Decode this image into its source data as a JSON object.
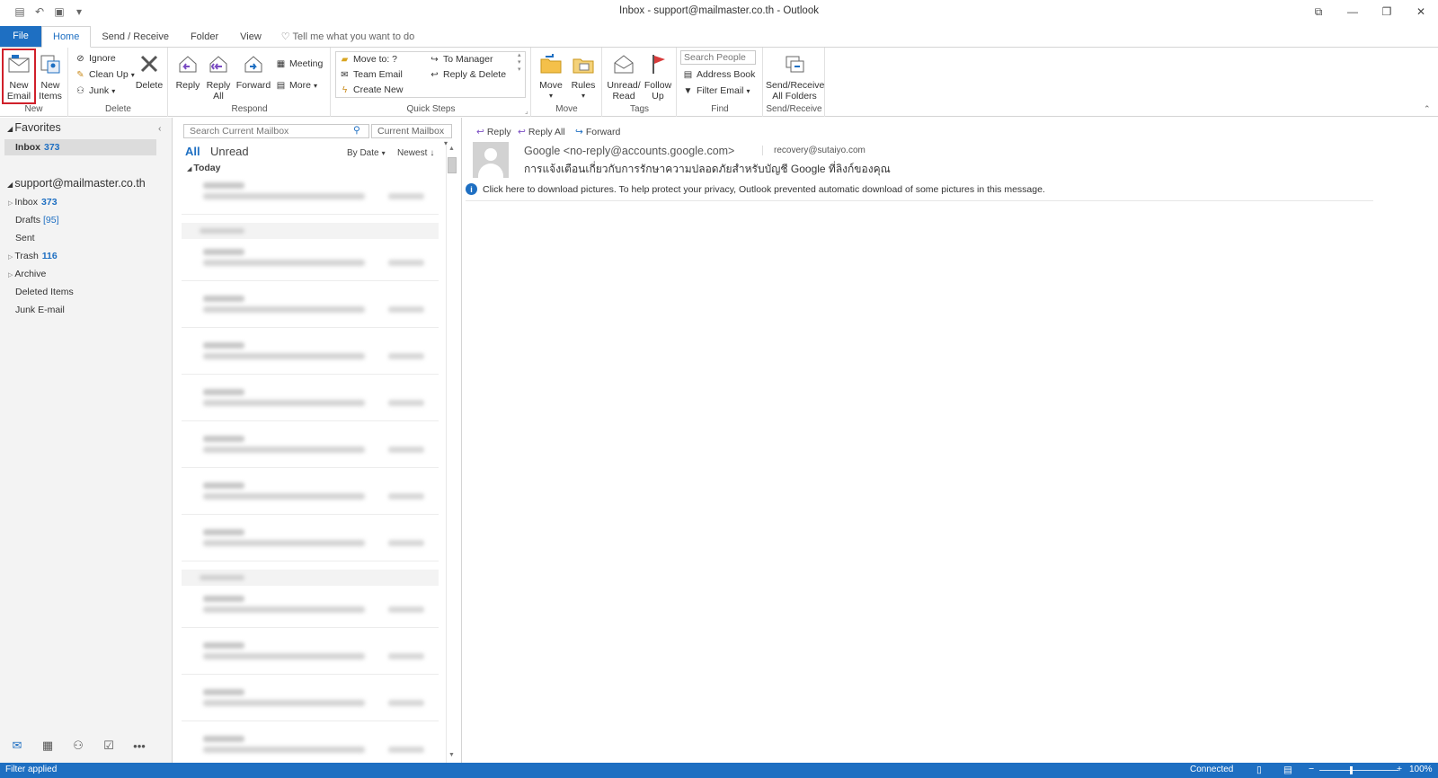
{
  "window": {
    "title": "Inbox - support@mailmaster.co.th  -  Outlook"
  },
  "tabs": [
    "File",
    "Home",
    "Send / Receive",
    "Folder",
    "View"
  ],
  "tell_me": "Tell me what you want to do",
  "ribbon": {
    "new": {
      "label": "New",
      "new_email": "New Email",
      "new_items": "New Items"
    },
    "delete": {
      "label": "Delete",
      "ignore": "Ignore",
      "clean_up": "Clean Up",
      "junk": "Junk",
      "delete": "Delete"
    },
    "respond": {
      "label": "Respond",
      "reply": "Reply",
      "reply_all": "Reply All",
      "forward": "Forward",
      "meeting": "Meeting",
      "more": "More"
    },
    "quick_steps": {
      "label": "Quick Steps",
      "move_to": "Move to: ?",
      "to_manager": "To Manager",
      "team_email": "Team Email",
      "reply_delete": "Reply & Delete",
      "create_new": "Create New"
    },
    "move": {
      "label": "Move",
      "move": "Move",
      "rules": "Rules"
    },
    "tags": {
      "label": "Tags",
      "unread_read": "Unread/ Read",
      "follow_up": "Follow Up"
    },
    "find": {
      "label": "Find",
      "search_people": "Search People",
      "address_book": "Address Book",
      "filter_email": "Filter Email"
    },
    "send_receive": {
      "label": "Send/Receive",
      "button": "Send/Receive All Folders"
    }
  },
  "nav": {
    "favorites": "Favorites",
    "fav_inbox": "Inbox",
    "fav_inbox_count": "373",
    "account": "support@mailmaster.co.th",
    "inbox": "Inbox",
    "inbox_count": "373",
    "drafts": "Drafts",
    "drafts_count": "[95]",
    "sent": "Sent",
    "trash": "Trash",
    "trash_count": "116",
    "archive": "Archive",
    "deleted_items": "Deleted Items",
    "junk": "Junk E-mail"
  },
  "list": {
    "search_placeholder": "Search Current Mailbox",
    "scope": "Current Mailbox",
    "filter_all": "All",
    "filter_unread": "Unread",
    "sort_by": "By Date",
    "sort_order": "Newest",
    "group_today": "Today"
  },
  "reading": {
    "reply": "Reply",
    "reply_all": "Reply All",
    "forward": "Forward",
    "from": "Google <no-reply@accounts.google.com>",
    "to": "recovery@sutaiyo.com",
    "subject": "การแจ้งเตือนเกี่ยวกับการรักษาความปลอดภัยสำหรับบัญชี Google ที่ลิงก์ของคุณ",
    "info": "Click here to download pictures. To help protect your privacy, Outlook prevented automatic download of some pictures in this message."
  },
  "status": {
    "filter": "Filter applied",
    "connection": "Connected",
    "zoom": "100%"
  },
  "colors": {
    "accent": "#1e6fc2",
    "highlight": "#d0202a",
    "flag": "#d83b3b"
  },
  "icons": [
    "new-email-icon",
    "new-items-icon",
    "ignore-icon",
    "clean-up-icon",
    "junk-icon",
    "delete-icon",
    "reply-icon",
    "reply-all-icon",
    "forward-icon",
    "meeting-icon",
    "more-icon",
    "move-icon",
    "rules-icon",
    "unread-read-icon",
    "flag-icon",
    "address-book-icon",
    "filter-icon",
    "send-receive-icon",
    "search-icon",
    "mail-icon",
    "calendar-icon",
    "people-icon",
    "tasks-icon",
    "info-icon"
  ]
}
